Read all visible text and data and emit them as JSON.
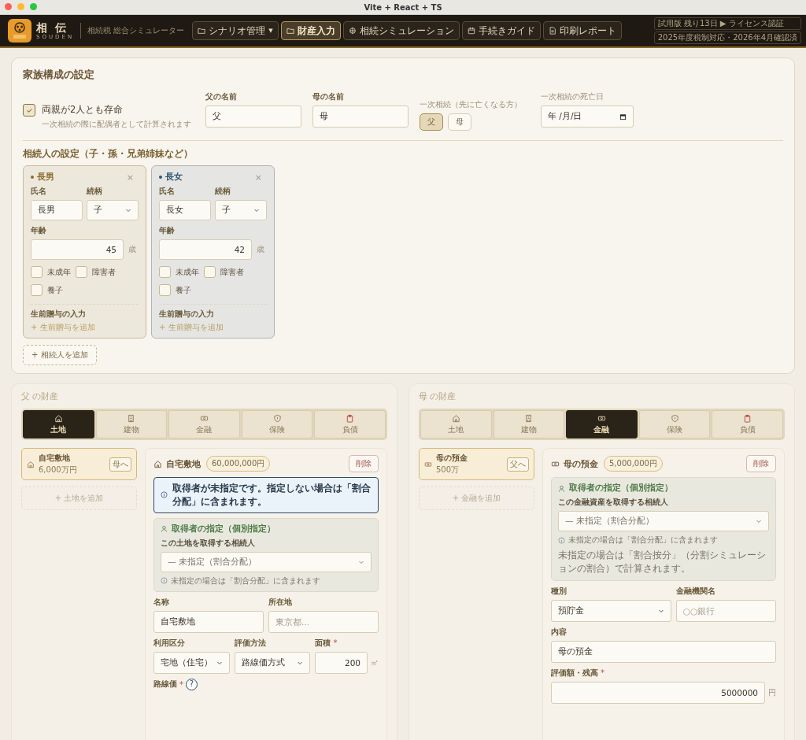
{
  "window": {
    "title": "Vite + React + TS"
  },
  "header": {
    "brand_name": "相伝",
    "brand_romaji": "SOUDEN",
    "subtitle": "相続税 総合シミュレーター",
    "nav": [
      {
        "label": "シナリオ管理",
        "caret": "▼",
        "selected": false
      },
      {
        "label": "財産入力",
        "selected": true
      },
      {
        "label": "相続シミュレーション",
        "selected": false
      },
      {
        "label": "手続きガイド",
        "selected": false
      },
      {
        "label": "印刷レポート",
        "selected": false
      }
    ],
    "badges": [
      "試用版 残り13日 ▶ ライセンス認証",
      "2025年度税制対応・2026年4月確認済"
    ]
  },
  "family": {
    "title": "家族構成の設定",
    "both_alive": {
      "label": "両親が2人とも存命",
      "hint": "一次相続の際に配偶者として計算されます",
      "checked": true
    },
    "father_name": {
      "label": "父の名前",
      "value": "父"
    },
    "mother_name": {
      "label": "母の名前",
      "value": "母"
    },
    "first_death": {
      "label": "一次相続（先に亡くなる方）",
      "options": [
        {
          "label": "父",
          "selected": true
        },
        {
          "label": "母",
          "selected": false
        }
      ]
    },
    "death_date": {
      "label": "一次相続の死亡日",
      "placeholder": "年 /月/日"
    },
    "heirs_title": "相続人の設定（子・孫・兄弟姉妹など）",
    "heirs": [
      {
        "title": "長男",
        "color": "#8a6a2a",
        "remove": "×",
        "name_label": "氏名",
        "name": "長男",
        "relation_label": "続柄",
        "relation": "子",
        "age_label": "年齢",
        "age": "45",
        "age_unit": "歳",
        "flags": [
          {
            "label": "未成年",
            "checked": false
          },
          {
            "label": "障害者",
            "checked": false
          },
          {
            "label": "養子",
            "checked": false
          }
        ],
        "gift_label": "生前贈与の入力",
        "gift_add": "+ 生前贈与を追加"
      },
      {
        "title": "長女",
        "color": "#2f5570",
        "remove": "×",
        "name_label": "氏名",
        "name": "長女",
        "relation_label": "続柄",
        "relation": "子",
        "age_label": "年齢",
        "age": "42",
        "age_unit": "歳",
        "flags": [
          {
            "label": "未成年",
            "checked": false
          },
          {
            "label": "障害者",
            "checked": false
          },
          {
            "label": "養子",
            "checked": false
          }
        ],
        "gift_label": "生前贈与の入力",
        "gift_add": "+ 生前贈与を追加"
      }
    ],
    "add_heir": "+ 相続人を追加"
  },
  "estates": [
    {
      "title": "父 の財産",
      "tabs": [
        {
          "label": "土地",
          "selected": true
        },
        {
          "label": "建物",
          "selected": false
        },
        {
          "label": "金融",
          "selected": false
        },
        {
          "label": "保険",
          "selected": false
        },
        {
          "label": "負債",
          "selected": false
        }
      ],
      "items": [
        {
          "name": "自宅敷地",
          "amount": "6,000万円",
          "transfer": "母へ",
          "selected": true
        }
      ],
      "add": "+ 土地を追加",
      "detail": {
        "name": "自宅敷地",
        "amount": "60,000,000円",
        "delete": "削除",
        "alert": "取得者が未指定です。指定しない場合は「割合分配」に含まれます。",
        "acquirer": {
          "title": "取得者の指定（個別指定）",
          "label": "この土地を取得する相続人",
          "placeholder": "— 未指定（割合分配）",
          "note": "未指定の場合は「割合分配」に含まれます"
        },
        "rows": [
          [
            {
              "kind": "text",
              "label": "名称",
              "value": "自宅敷地"
            },
            {
              "kind": "text",
              "label": "所在地",
              "placeholder": "東京都..."
            }
          ],
          [
            {
              "kind": "select",
              "label": "利用区分",
              "value": "宅地（住宅）"
            },
            {
              "kind": "select",
              "label": "評価方法",
              "value": "路線価方式"
            },
            {
              "kind": "number",
              "label": "面積",
              "required_mark": "*",
              "value": "200",
              "unit": "㎡"
            }
          ],
          [
            {
              "kind": "help",
              "label": "路線価",
              "required_mark": "*",
              "help": "?"
            }
          ]
        ]
      }
    },
    {
      "title": "母 の財産",
      "tabs": [
        {
          "label": "土地",
          "selected": false
        },
        {
          "label": "建物",
          "selected": false
        },
        {
          "label": "金融",
          "selected": true
        },
        {
          "label": "保険",
          "selected": false
        },
        {
          "label": "負債",
          "selected": false
        }
      ],
      "items": [
        {
          "name": "母の預金",
          "amount": "500万",
          "transfer": "父へ",
          "selected": true
        }
      ],
      "add": "+ 金融を追加",
      "detail": {
        "name": "母の預金",
        "amount": "5,000,000円",
        "delete": "削除",
        "acquirer": {
          "title": "取得者の指定（個別指定）",
          "label": "この金融資産を取得する相続人",
          "placeholder": "— 未指定（割合分配）",
          "note": "未指定の場合は「割合分配」に含まれます",
          "extra": "未指定の場合は「割合按分」（分割シミュレーションの割合）で計算されます。"
        },
        "rows": [
          [
            {
              "kind": "select",
              "label": "種別",
              "value": "預貯金"
            },
            {
              "kind": "text",
              "label": "金融機関名",
              "placeholder": "○○銀行"
            }
          ],
          [
            {
              "kind": "text",
              "label": "内容",
              "value": "母の預金"
            }
          ],
          [
            {
              "kind": "number",
              "label": "評価額・残高",
              "required_mark": "*",
              "value": "5000000",
              "unit": "円"
            }
          ]
        ]
      }
    }
  ]
}
